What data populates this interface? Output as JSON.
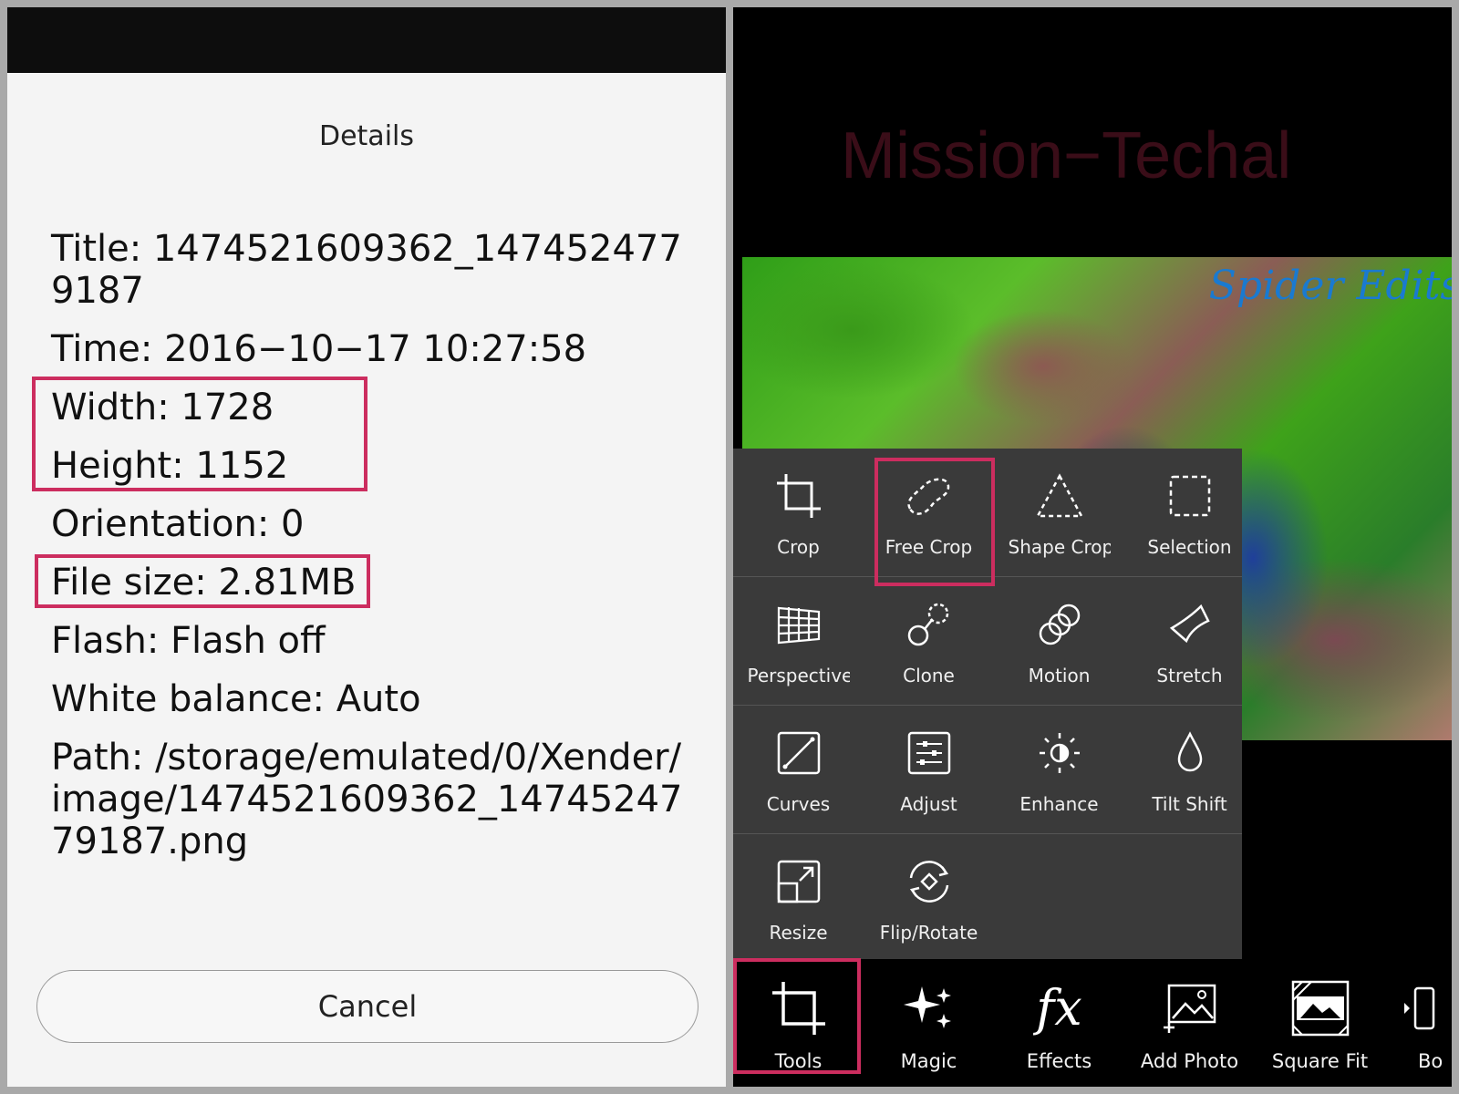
{
  "details_dialog": {
    "title": "Details",
    "rows": [
      "Title: 1474521609362_1474524779187",
      "Time: 2016−10−17 10:27:58",
      "Width: 1728",
      "Height: 1152",
      "Orientation: 0",
      "File size: 2.81MB",
      "Flash: Flash off",
      "White balance: Auto",
      "Path: /storage/emulated/0/Xender/image/1474521609362_1474524779187.png"
    ],
    "cancel_label": "Cancel"
  },
  "editor": {
    "watermark": "Mission−Techal",
    "photo_logo": "Spider Edits",
    "tools": [
      {
        "label": "Crop",
        "icon": "crop-icon"
      },
      {
        "label": "Free Crop",
        "icon": "free-crop-icon"
      },
      {
        "label": "Shape Crop",
        "icon": "shape-crop-icon"
      },
      {
        "label": "Selection",
        "icon": "selection-icon"
      },
      {
        "label": "Perspective",
        "icon": "perspective-icon"
      },
      {
        "label": "Clone",
        "icon": "clone-icon"
      },
      {
        "label": "Motion",
        "icon": "motion-icon"
      },
      {
        "label": "Stretch",
        "icon": "stretch-icon"
      },
      {
        "label": "Curves",
        "icon": "curves-icon"
      },
      {
        "label": "Adjust",
        "icon": "adjust-icon"
      },
      {
        "label": "Enhance",
        "icon": "enhance-icon"
      },
      {
        "label": "Tilt Shift",
        "icon": "tilt-shift-icon"
      },
      {
        "label": "Resize",
        "icon": "resize-icon"
      },
      {
        "label": "Flip/Rotate",
        "icon": "flip-rotate-icon"
      }
    ],
    "bottom_bar": [
      {
        "label": "Tools",
        "icon": "crop-icon"
      },
      {
        "label": "Magic",
        "icon": "sparkle-icon"
      },
      {
        "label": "Effects",
        "icon": "fx-icon"
      },
      {
        "label": "Add Photo",
        "icon": "add-photo-icon"
      },
      {
        "label": "Square Fit",
        "icon": "square-fit-icon"
      },
      {
        "label": "Bo",
        "icon": "border-icon"
      }
    ]
  },
  "colors": {
    "highlight": "#cc2d5f",
    "menu_bg": "#3a3a3a",
    "watermark": "#3a0d18"
  }
}
